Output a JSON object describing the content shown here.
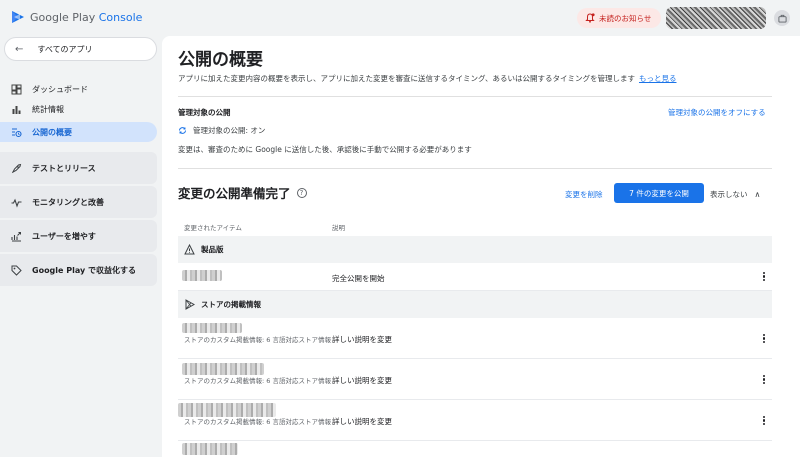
{
  "header": {
    "logo_text": "Google Play",
    "logo_accent": "Console",
    "notification_label": "未読のお知らせ",
    "colors": {
      "accent": "#1a73e8",
      "alert": "#c5221f"
    }
  },
  "sidebar": {
    "back_label": "すべてのアプリ",
    "items": [
      {
        "label": "ダッシュボード",
        "icon": "dashboard-icon"
      },
      {
        "label": "統計情報",
        "icon": "bar-chart-icon"
      },
      {
        "label": "公開の概要",
        "icon": "publishing-overview-icon",
        "active": true
      }
    ],
    "sections": [
      {
        "label": "テストとリリース",
        "icon": "rocket-icon"
      },
      {
        "label": "モニタリングと改善",
        "icon": "monitoring-icon"
      },
      {
        "label": "ユーザーを増やす",
        "icon": "grow-users-icon"
      },
      {
        "label": "Google Play で収益化する",
        "icon": "tag-icon"
      }
    ]
  },
  "main": {
    "title": "公開の概要",
    "description": "アプリに加えた変更内容の概要を表示し、アプリに加えた変更を審査に送信するタイミング、あるいは公開するタイミングを管理します",
    "learn_more": "もっと見る",
    "managed": {
      "title": "管理対象の公開",
      "turn_off": "管理対象の公開をオフにする",
      "status": "管理対象の公開: オン",
      "note": "変更は、審査のために Google に送信した後、承認後に手動で公開する必要があります"
    },
    "ready": {
      "title": "変更の公開準備完了",
      "remove_changes": "変更を削除",
      "publish_button": "7 件の変更を公開",
      "hide": "表示しない"
    },
    "table": {
      "col_item": "変更されたアイテム",
      "col_desc": "説明",
      "groups": [
        {
          "name": "製品版",
          "icon": "warning-triangle-icon",
          "rows": [
            {
              "sub": "",
              "desc": "完全公開を開始"
            }
          ]
        },
        {
          "name": "ストアの掲載情報",
          "icon": "play-store-icon",
          "rows": [
            {
              "sub": "ストアのカスタム掲載情報: 6 言語対応ストア情報",
              "desc": "詳しい説明を変更"
            },
            {
              "sub": "ストアのカスタム掲載情報: 6 言語対応ストア情報",
              "desc": "詳しい説明を変更"
            },
            {
              "sub": "ストアのカスタム掲載情報: 6 言語対応ストア情報",
              "desc": "詳しい説明を変更"
            }
          ]
        }
      ]
    }
  }
}
